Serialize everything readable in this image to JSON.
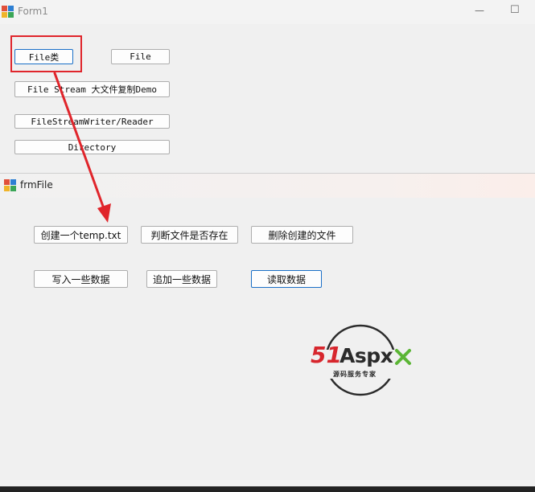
{
  "form1": {
    "title": "Form1",
    "buttons": {
      "file_class": "File类",
      "file": "File",
      "file_stream": "File Stream 大文件复制Demo",
      "stream_writer_reader": "FileStreamWriter/Reader",
      "directory": "Directory"
    },
    "controls": {
      "minimize": "—",
      "maximize": "☐"
    }
  },
  "frmFile": {
    "title": "frmFile",
    "buttons": {
      "create": "创建一个temp.txt",
      "exists": "判断文件是否存在",
      "delete": "删除创建的文件",
      "write": "写入一些数据",
      "append": "追加一些数据",
      "read": "读取数据"
    }
  },
  "logo": {
    "brand_51": "51",
    "brand_aspx": "Aspx",
    "tagline": "源码服务专家",
    "colors": {
      "red": "#d7262d",
      "dark": "#2b2b2b",
      "green": "#5bb535"
    }
  },
  "annotation": {
    "color": "#e0252b"
  }
}
